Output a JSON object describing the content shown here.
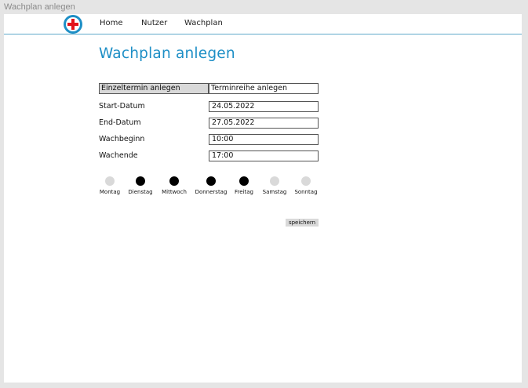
{
  "frame": {
    "label": "Wachplan anlegen"
  },
  "nav": {
    "logo": "red-cross-logo-icon",
    "items": [
      {
        "label": "Home"
      },
      {
        "label": "Nutzer"
      },
      {
        "label": "Wachplan"
      }
    ]
  },
  "page": {
    "title": "Wachplan anlegen"
  },
  "modes": [
    {
      "label": "Einzeltermin anlegen",
      "active": true
    },
    {
      "label": "Terminreihe anlegen",
      "active": false
    }
  ],
  "fields": [
    {
      "label": "Start-Datum",
      "value": "24.05.2022"
    },
    {
      "label": "End-Datum",
      "value": "27.05.2022"
    },
    {
      "label": "Wachbeginn",
      "value": "10:00"
    },
    {
      "label": "Wachende",
      "value": "17:00"
    }
  ],
  "days": [
    {
      "label": "Montag",
      "selected": false
    },
    {
      "label": "Dienstag",
      "selected": true
    },
    {
      "label": "Mittwoch",
      "selected": true
    },
    {
      "label": "Donnerstag",
      "selected": true
    },
    {
      "label": "Freitag",
      "selected": true
    },
    {
      "label": "Samstag",
      "selected": false
    },
    {
      "label": "Sonntag",
      "selected": false
    }
  ],
  "actions": {
    "save_label": "speichern"
  },
  "colors": {
    "accent": "#1e8fc6",
    "cross": "#e3141b",
    "selected_day": "#000000",
    "unselected_day": "#d9d9d9"
  }
}
